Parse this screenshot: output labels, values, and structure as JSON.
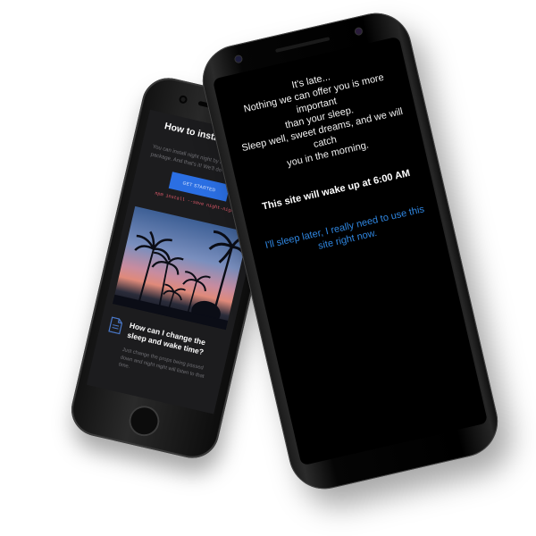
{
  "back_screen": {
    "header_title": "How to install ni",
    "intro_text": "You can install night night by installing the package. And that's it! We'll do the",
    "cta_label": "GET STARTED",
    "code_snippet": "npm install --save night-night",
    "feature_title": "How can I change the sleep and wake time?",
    "feature_description": "Just change the props being passed down and night night will listen to that time."
  },
  "front_screen": {
    "message_lines": [
      "It's late...",
      "Nothing we can offer you is more important",
      "than your sleep.",
      "Sleep well, sweet dreams, and we will catch",
      "you in the morning."
    ],
    "wake_notice": "This site will wake up at 6:00 AM",
    "override_link": "I'll sleep later, I really need to use this site right now."
  },
  "colors": {
    "page_background": "#ffffff",
    "screen_background": "#000000",
    "message_text": "#f2f2f2",
    "link": "#2f86e0",
    "cta_button": "#2b6fe3",
    "code_text": "#e05a6a"
  },
  "icons": {
    "feature_icon": "document-icon",
    "home_button": "home-button"
  }
}
